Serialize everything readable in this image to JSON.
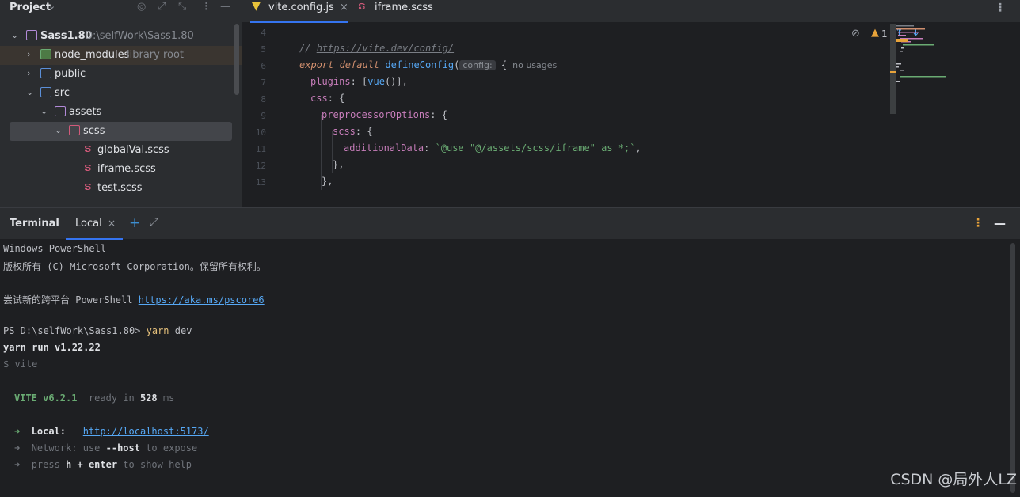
{
  "project": {
    "title": "Project",
    "root": {
      "name": "Sass1.80",
      "path": "D:\\selfWork\\Sass1.80"
    },
    "items": [
      {
        "name": "node_modules",
        "hint": "library root"
      },
      {
        "name": "public"
      },
      {
        "name": "src"
      },
      {
        "name": "assets"
      },
      {
        "name": "scss"
      },
      {
        "name": "globalVal.scss"
      },
      {
        "name": "iframe.scss"
      },
      {
        "name": "test.scss"
      }
    ]
  },
  "editor": {
    "tabs": [
      {
        "label": "vite.config.js"
      },
      {
        "label": "iframe.scss"
      }
    ],
    "warnings": "1",
    "lines": {
      "n4": "4",
      "n5": "5",
      "n6": "6",
      "n7": "7",
      "n8": "8",
      "n9": "9",
      "n10": "10",
      "n11": "11",
      "n12": "12",
      "n13": "13"
    },
    "code": {
      "l5_comment": "// ",
      "l5_url": "https://vite.dev/config/",
      "l6_kw": "export default ",
      "l6_fn": "defineConfig",
      "l6_paren": "(",
      "l6_hint": "config:",
      "l6_brace": " {",
      "l6_usages": "  no usages",
      "l7_prop": "plugins",
      "l7_a": ": [",
      "l7_fn": "vue",
      "l7_b": "()],",
      "l8_prop": "css",
      "l8_a": ": {",
      "l9_prop": "preprocessorOptions",
      "l9_a": ": {",
      "l10_prop": "scss",
      "l10_a": ": {",
      "l11_prop": "additionalData",
      "l11_a": ": ",
      "l11_str": "`@use \"@/assets/scss/iframe\" as *;`",
      "l11_b": ",",
      "l12": "},",
      "l13": "},"
    }
  },
  "terminal": {
    "title": "Terminal",
    "tab": "Local",
    "lines": {
      "l1": "Windows PowerShell",
      "l2": "版权所有 (C) Microsoft Corporation。保留所有权利。",
      "l3_a": "尝试新的跨平台 PowerShell ",
      "l3_link": "https://aka.ms/pscore6",
      "l4_prompt": "PS D:\\selfWork\\Sass1.80> ",
      "l4_cmd": "yarn",
      "l4_arg": " dev",
      "l5": "yarn run v1.22.22",
      "l6": "$ vite",
      "l7_vite": "VITE v6.2.1",
      "l7_ready": "  ready in ",
      "l7_ms": "528",
      "l7_unit": " ms",
      "l8_label": "Local:",
      "l8_link": "http://localhost:5173/",
      "l9_label": "Network",
      "l9_a": ": use ",
      "l9_bold": "--host",
      "l9_b": " to expose",
      "l10_a": "press ",
      "l10_h": "h + enter",
      "l10_b": " to show help"
    }
  },
  "watermark": "CSDN @局外人LZ",
  "colors": {
    "accent": "#3574f0",
    "link": "#56a8f5",
    "string": "#6aab73",
    "warning": "#e8a33a"
  }
}
